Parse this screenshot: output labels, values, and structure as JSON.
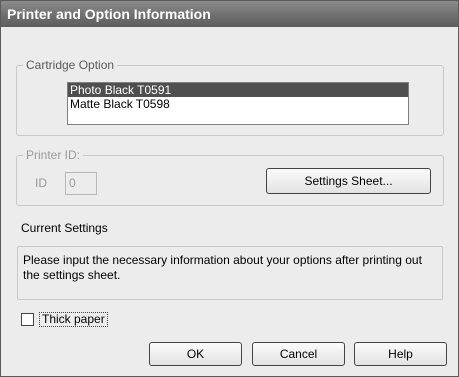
{
  "window": {
    "title": "Printer and Option Information"
  },
  "cartridge": {
    "legend": "Cartridge Option",
    "items": [
      {
        "label": "Photo Black T0591",
        "selected": true
      },
      {
        "label": "Matte Black T0598",
        "selected": false
      }
    ]
  },
  "printer_id": {
    "legend": "Printer ID:",
    "id_label": "ID",
    "id_value": "0",
    "settings_sheet_button": "Settings Sheet..."
  },
  "current_settings": {
    "label": "Current Settings",
    "message": "Please input the necessary information about your options after printing out the settings sheet."
  },
  "thick_paper": {
    "label": "Thick paper",
    "checked": false
  },
  "buttons": {
    "ok": "OK",
    "cancel": "Cancel",
    "help": "Help"
  }
}
